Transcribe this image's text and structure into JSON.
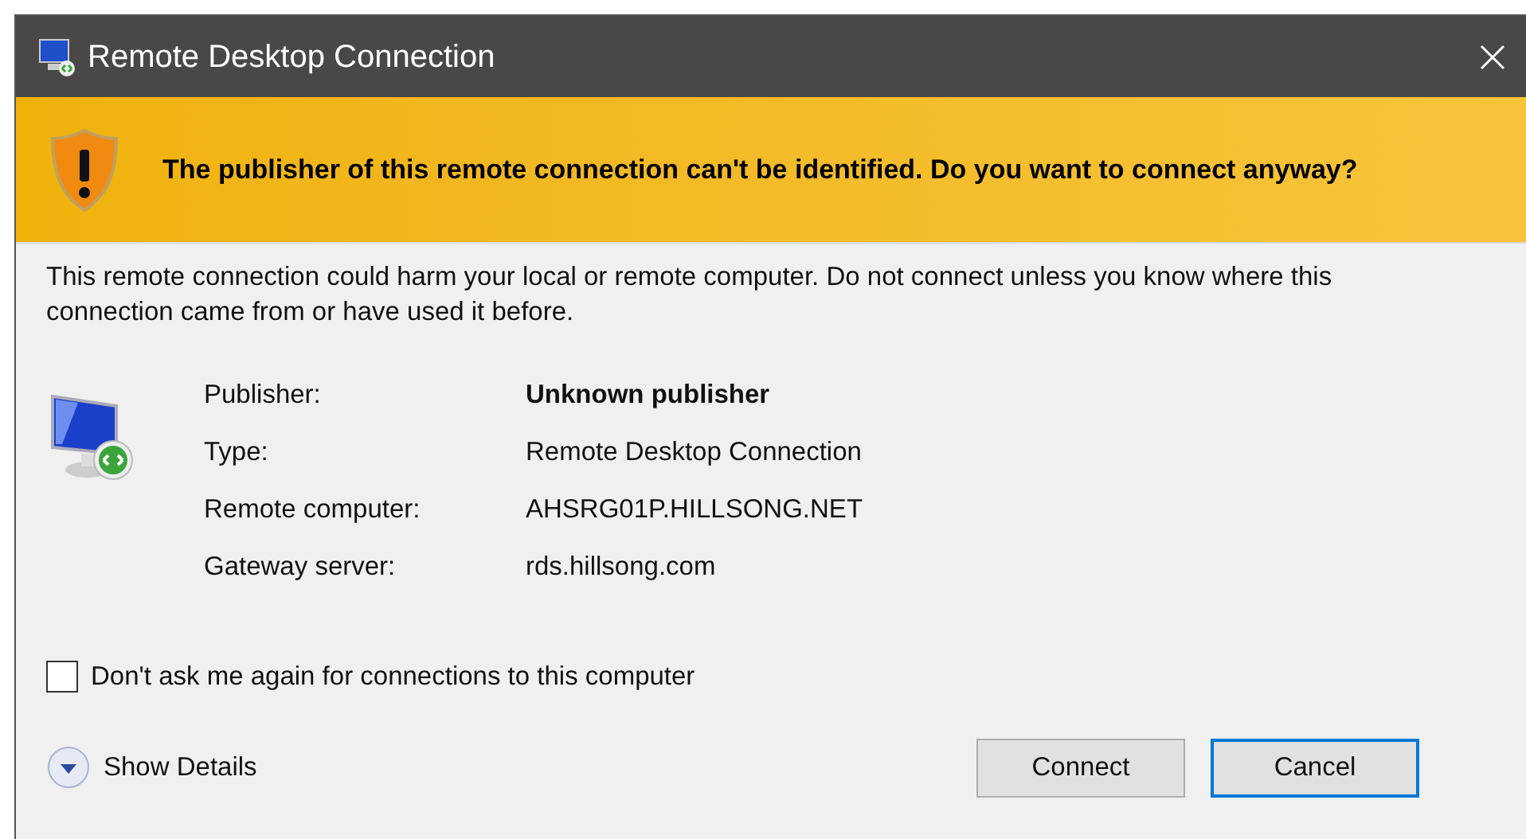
{
  "window": {
    "title": "Remote Desktop Connection"
  },
  "warning": "The publisher of this remote connection can't be identified. Do you want to connect anyway?",
  "description": "This remote connection could harm your local or remote computer. Do not connect unless you know where this connection came from or have used it before.",
  "details": [
    {
      "label": "Publisher:",
      "value": "Unknown publisher",
      "emphasized": true
    },
    {
      "label": "Type:",
      "value": "Remote Desktop Connection",
      "emphasized": false
    },
    {
      "label": "Remote computer:",
      "value": "AHSRG01P.HILLSONG.NET",
      "emphasized": false
    },
    {
      "label": "Gateway server:",
      "value": "rds.hillsong.com",
      "emphasized": false
    }
  ],
  "dont_ask_checkbox": {
    "label": "Don't ask me again for connections to this computer",
    "checked": false
  },
  "show_details": {
    "label": "Show Details",
    "expanded": false
  },
  "buttons": [
    {
      "label": "Connect",
      "default": false
    },
    {
      "label": "Cancel",
      "default": true
    }
  ]
}
